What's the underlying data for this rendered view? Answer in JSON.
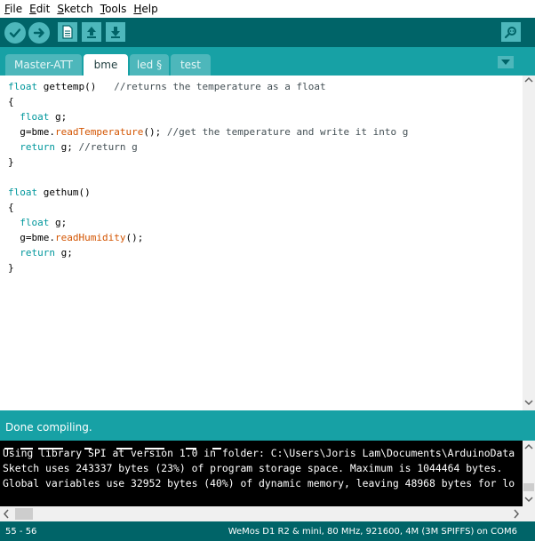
{
  "menu": {
    "items": [
      {
        "accel": "F",
        "rest": "ile"
      },
      {
        "accel": "E",
        "rest": "dit"
      },
      {
        "accel": "S",
        "rest": "ketch"
      },
      {
        "accel": "T",
        "rest": "ools"
      },
      {
        "accel": "H",
        "rest": "elp"
      }
    ]
  },
  "toolbar": {
    "verify_icon": "check-icon",
    "upload_icon": "arrow-right-icon",
    "new_icon": "file-icon",
    "open_icon": "arrow-up-icon",
    "save_icon": "arrow-down-icon",
    "serial_icon": "magnifier-icon"
  },
  "tabs": [
    {
      "label": "Master-ATT",
      "active": false
    },
    {
      "label": "bme",
      "active": true
    },
    {
      "label": "led §",
      "active": false
    },
    {
      "label": "test",
      "active": false
    }
  ],
  "editor": {
    "lines": [
      [
        {
          "t": "float",
          "c": "kw"
        },
        {
          "t": " gettemp()   ",
          "c": ""
        },
        {
          "t": "//returns the temperature as a float",
          "c": "cm"
        }
      ],
      [
        {
          "t": "{",
          "c": ""
        }
      ],
      [
        {
          "t": "  ",
          "c": ""
        },
        {
          "t": "float",
          "c": "kw"
        },
        {
          "t": " g;",
          "c": ""
        }
      ],
      [
        {
          "t": "  g=bme.",
          "c": ""
        },
        {
          "t": "readTemperature",
          "c": "fn"
        },
        {
          "t": "(); ",
          "c": ""
        },
        {
          "t": "//get the temperature and write it into g",
          "c": "cm"
        }
      ],
      [
        {
          "t": "  ",
          "c": ""
        },
        {
          "t": "return",
          "c": "kw"
        },
        {
          "t": " g; ",
          "c": ""
        },
        {
          "t": "//return g",
          "c": "cm"
        }
      ],
      [
        {
          "t": "}",
          "c": ""
        }
      ],
      [],
      [
        {
          "t": "float",
          "c": "kw"
        },
        {
          "t": " gethum()",
          "c": ""
        }
      ],
      [
        {
          "t": "{",
          "c": ""
        }
      ],
      [
        {
          "t": "  ",
          "c": ""
        },
        {
          "t": "float",
          "c": "kw"
        },
        {
          "t": " g;",
          "c": ""
        }
      ],
      [
        {
          "t": "  g=bme.",
          "c": ""
        },
        {
          "t": "readHumidity",
          "c": "fn"
        },
        {
          "t": "();",
          "c": ""
        }
      ],
      [
        {
          "t": "  ",
          "c": ""
        },
        {
          "t": "return",
          "c": "kw"
        },
        {
          "t": " g;",
          "c": ""
        }
      ],
      [
        {
          "t": "}",
          "c": ""
        }
      ]
    ]
  },
  "status": {
    "text": "Done compiling."
  },
  "console": {
    "lines": [
      "Using library SPI at version 1.0 in folder: C:\\Users\\Joris Lam\\Documents\\ArduinoData",
      "Sketch uses 243337 bytes (23%) of program storage space. Maximum is 1044464 bytes.",
      "Global variables use 32952 bytes (40%) of dynamic memory, leaving 48968 bytes for lo"
    ]
  },
  "footer": {
    "line": "55 - 56",
    "board": "WeMos D1 R2 & mini, 80 MHz, 921600, 4M (3M SPIFFS) on COM6"
  },
  "colors": {
    "toolbar_bg": "#006468",
    "tab_strip_bg": "#17a1a5",
    "button_fill": "#4db7bb",
    "keyword": "#00979c",
    "function": "#d35400",
    "comment": "#434f54"
  }
}
